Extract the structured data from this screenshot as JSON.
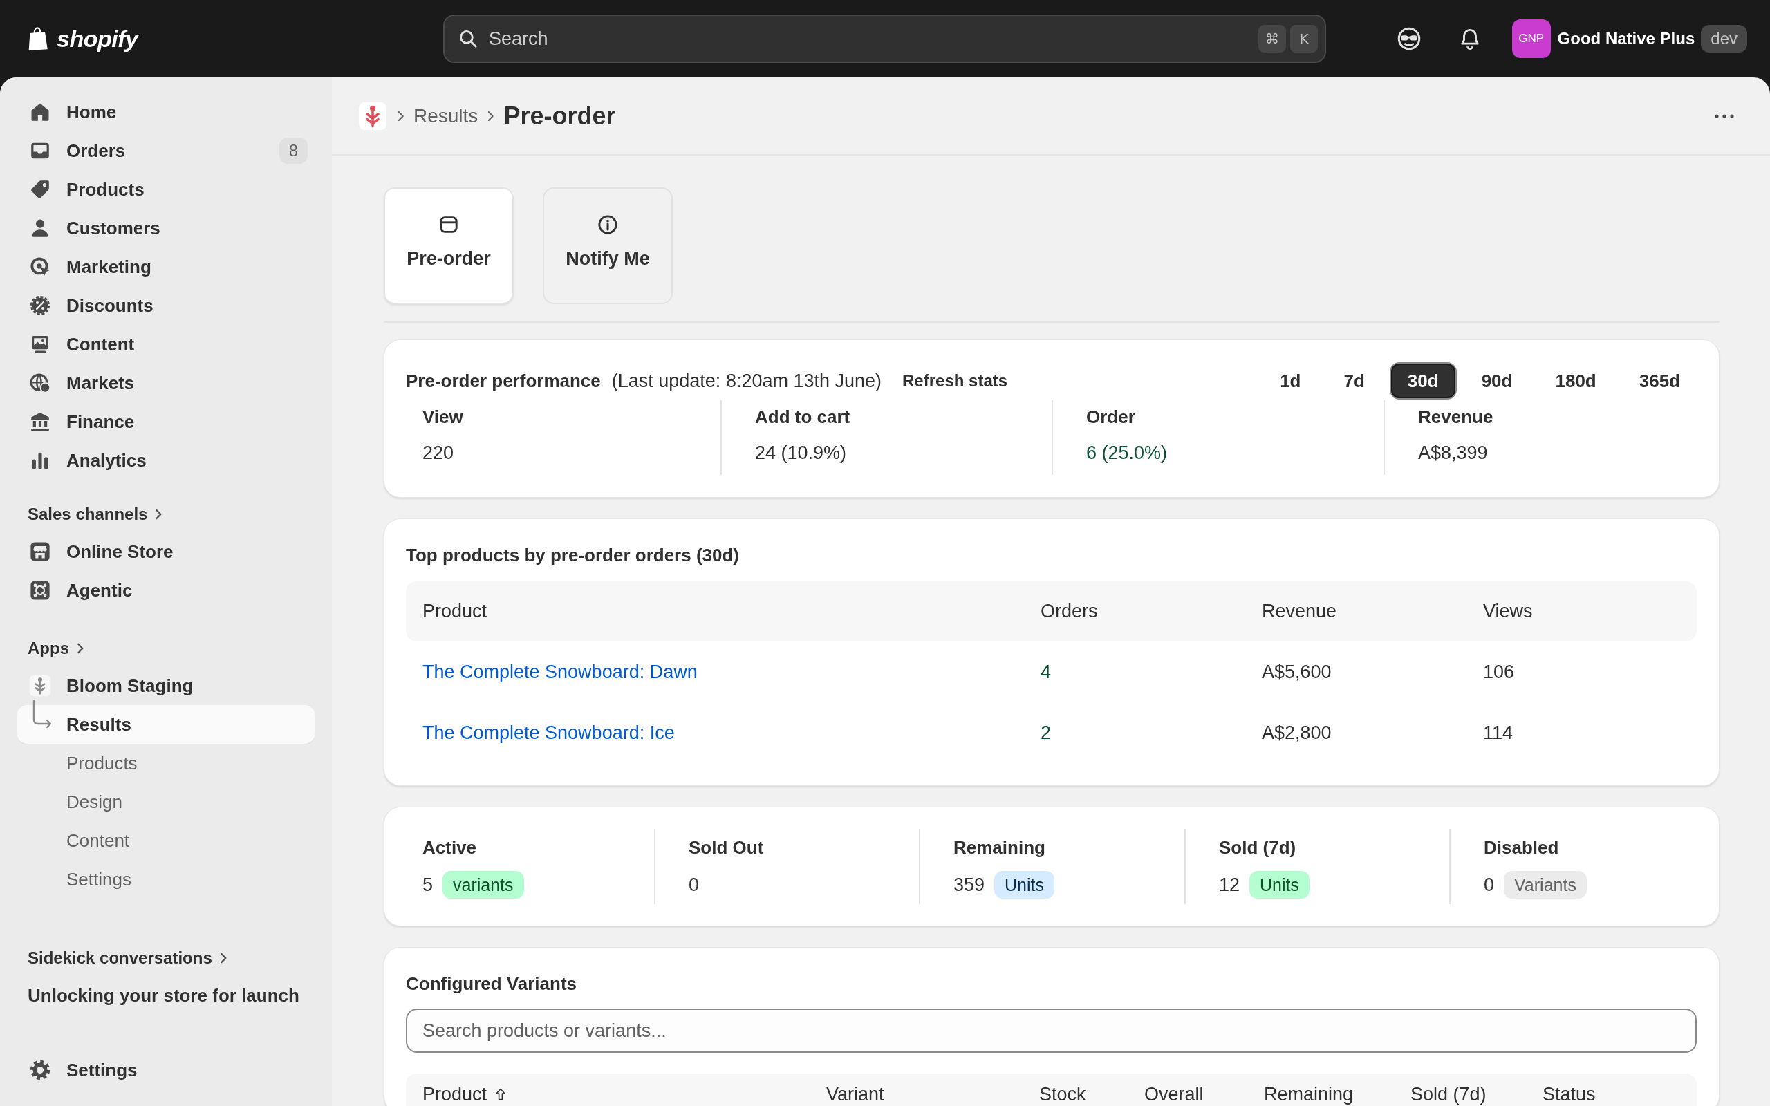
{
  "top_bar": {
    "brand": "shopify",
    "search": {
      "placeholder": "Search",
      "shortcut": [
        "⌘",
        "K"
      ]
    },
    "store": {
      "initials": "GNP",
      "name": "Good Native Plus",
      "badge": "dev"
    }
  },
  "sidebar": {
    "items": [
      {
        "label": "Home",
        "selected": false
      },
      {
        "label": "Orders",
        "badge": "8",
        "selected": false
      },
      {
        "label": "Products",
        "selected": false
      },
      {
        "label": "Customers",
        "selected": false
      },
      {
        "label": "Marketing",
        "selected": false
      },
      {
        "label": "Discounts",
        "selected": false
      },
      {
        "label": "Content",
        "selected": false
      },
      {
        "label": "Markets",
        "selected": false
      },
      {
        "label": "Finance",
        "selected": false
      },
      {
        "label": "Analytics",
        "selected": false
      }
    ],
    "sections": [
      {
        "title": "Sales channels",
        "items": [
          {
            "label": "Online Store",
            "selected": false
          },
          {
            "label": "Agentic",
            "selected": false
          }
        ]
      },
      {
        "title": "Apps",
        "items": [
          {
            "label": "Bloom Staging",
            "selected": false,
            "children": [
              {
                "label": "Results",
                "selected": true
              },
              {
                "label": "Products",
                "selected": false
              },
              {
                "label": "Design",
                "selected": false
              },
              {
                "label": "Content",
                "selected": false
              },
              {
                "label": "Settings",
                "selected": false
              }
            ]
          }
        ]
      },
      {
        "title": "Sidekick conversations",
        "items": [
          {
            "label": "Unlocking your store for launch",
            "selected": false
          }
        ]
      }
    ],
    "footer": {
      "label": "Settings",
      "selected": false
    }
  },
  "page_header": {
    "breadcrumb": [
      "Results"
    ],
    "title": "Pre-order"
  },
  "tabs": [
    {
      "label": "Pre-order",
      "selected": true
    },
    {
      "label": "Notify Me",
      "selected": false
    }
  ],
  "performance": {
    "title": "Pre-order performance",
    "last_update": "(Last update: 8:20am 13th June)",
    "refresh_label": "Refresh stats",
    "periods": [
      {
        "label": "1d",
        "selected": false
      },
      {
        "label": "7d",
        "selected": false
      },
      {
        "label": "30d",
        "selected": true
      },
      {
        "label": "90d",
        "selected": false
      },
      {
        "label": "180d",
        "selected": false
      },
      {
        "label": "365d",
        "selected": false
      }
    ],
    "metrics": [
      {
        "label": "View",
        "value": "220",
        "color": "#303030"
      },
      {
        "label": "Add to cart",
        "value": "24 (10.9%)",
        "color": "#303030"
      },
      {
        "label": "Order",
        "value": "6 (25.0%)",
        "color": "#0c5132"
      },
      {
        "label": "Revenue",
        "value": "A$8,399",
        "color": "#303030"
      }
    ]
  },
  "top_products": {
    "title": "Top products by pre-order orders (30d)",
    "columns": [
      "Product",
      "Orders",
      "Revenue",
      "Views"
    ],
    "rows": [
      {
        "product": "The Complete Snowboard: Dawn",
        "orders": "4",
        "revenue": "A$5,600",
        "views": "106"
      },
      {
        "product": "The Complete Snowboard: Ice",
        "orders": "2",
        "revenue": "A$2,800",
        "views": "114"
      }
    ]
  },
  "summary": [
    {
      "label": "Active",
      "value": "5",
      "badge": {
        "text": "variants",
        "color": "#b4fed2"
      }
    },
    {
      "label": "Sold Out",
      "value": "0"
    },
    {
      "label": "Remaining",
      "value": "359",
      "badge": {
        "text": "Units",
        "color": "#d5ebff"
      }
    },
    {
      "label": "Sold (7d)",
      "value": "12",
      "badge": {
        "text": "Units",
        "color": "#b4fed2"
      }
    },
    {
      "label": "Disabled",
      "value": "0",
      "badge": {
        "text": "Variants",
        "color": "#ebebeb"
      }
    }
  ],
  "configured_variants": {
    "title": "Configured Variants",
    "search": {
      "placeholder": "Search products or variants..."
    },
    "columns": [
      {
        "label": "Product",
        "sorted": true
      },
      {
        "label": "Variant",
        "sorted": false
      },
      {
        "label": "Stock",
        "sorted": false
      },
      {
        "label": "Overall",
        "sorted": false
      },
      {
        "label": "Remaining",
        "sorted": false
      },
      {
        "label": "Sold (7d)",
        "sorted": false
      },
      {
        "label": "Status",
        "sorted": false
      }
    ]
  }
}
